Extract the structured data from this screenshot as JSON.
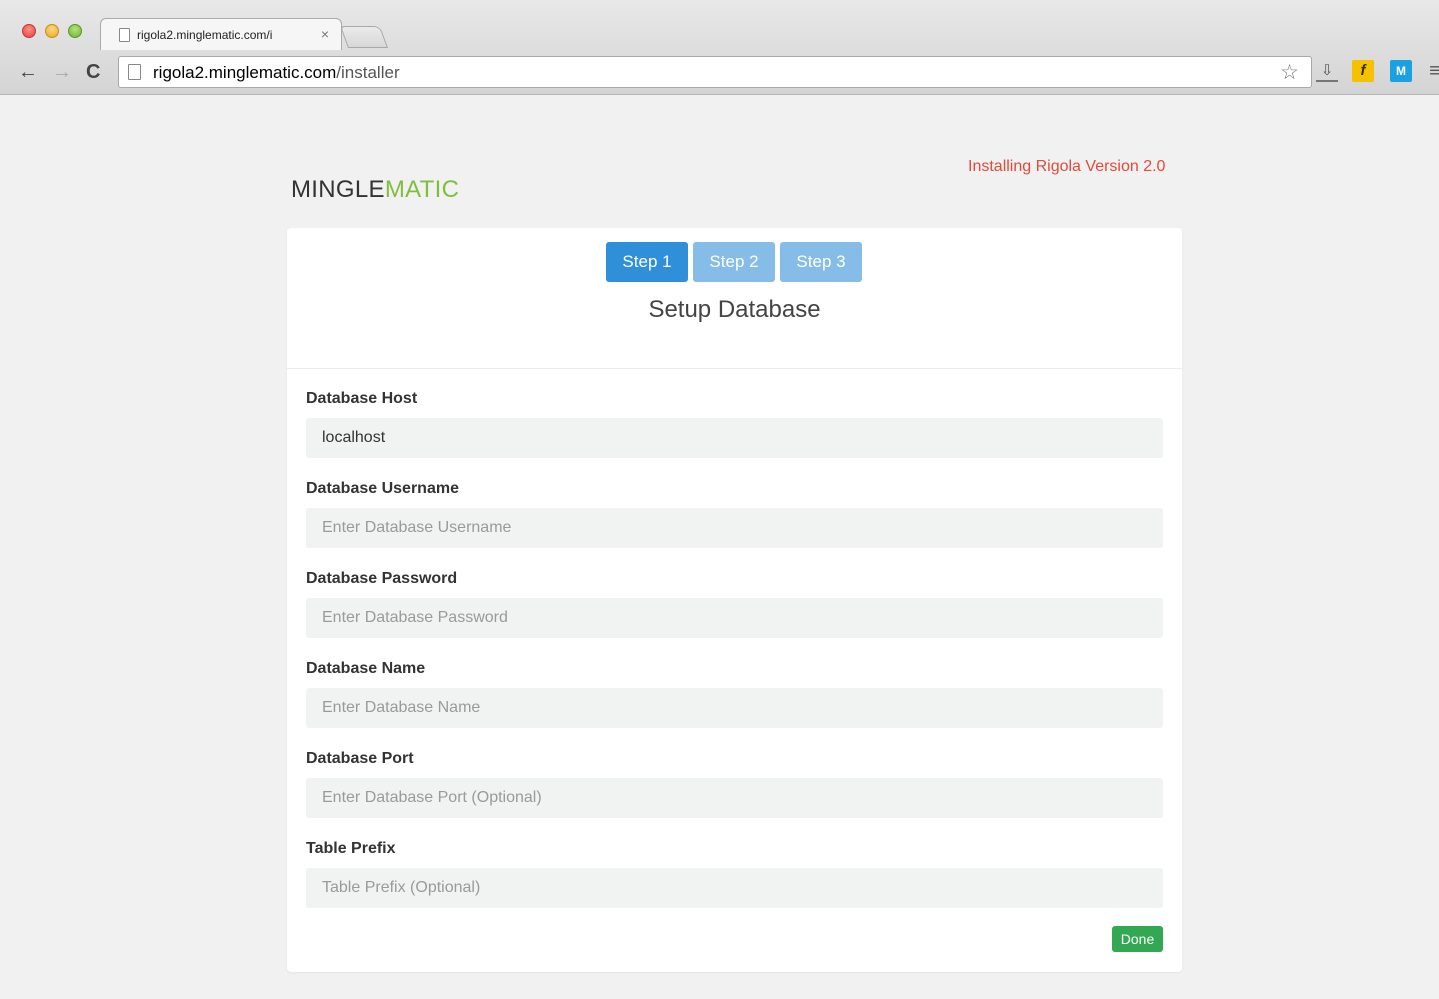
{
  "browser": {
    "tab_title": "rigola2.minglematic.com/i",
    "tab_close": "×",
    "url_host": "rigola2.minglematic.com",
    "url_path": "/installer",
    "nav": {
      "back": "←",
      "forward": "→",
      "reload": "C"
    },
    "star": "☆",
    "extensions": {
      "download": "⇩",
      "f": "f",
      "m": "M",
      "menu": "≡"
    }
  },
  "header": {
    "logo_part1": "MINGLE",
    "logo_part2": "MATIC",
    "version_text": "Installing Rigola Version 2.0"
  },
  "steps": [
    {
      "label": "Step 1",
      "active": true
    },
    {
      "label": "Step 2",
      "active": false
    },
    {
      "label": "Step 3",
      "active": false
    }
  ],
  "form": {
    "title": "Setup Database",
    "fields": [
      {
        "label": "Database Host",
        "value": "localhost",
        "placeholder": ""
      },
      {
        "label": "Database Username",
        "value": "",
        "placeholder": "Enter Database Username"
      },
      {
        "label": "Database Password",
        "value": "",
        "placeholder": "Enter Database Password"
      },
      {
        "label": "Database Name",
        "value": "",
        "placeholder": "Enter Database Name"
      },
      {
        "label": "Database Port",
        "value": "",
        "placeholder": "Enter Database Port (Optional)"
      },
      {
        "label": "Table Prefix",
        "value": "",
        "placeholder": "Table Prefix (Optional)"
      }
    ],
    "done_label": "Done"
  },
  "colors": {
    "step_active": "#2f8fd8",
    "step_inactive": "#86bde8",
    "logo_accent": "#7fbf3f",
    "version_text": "#e14b3a",
    "done_button": "#33a852"
  }
}
